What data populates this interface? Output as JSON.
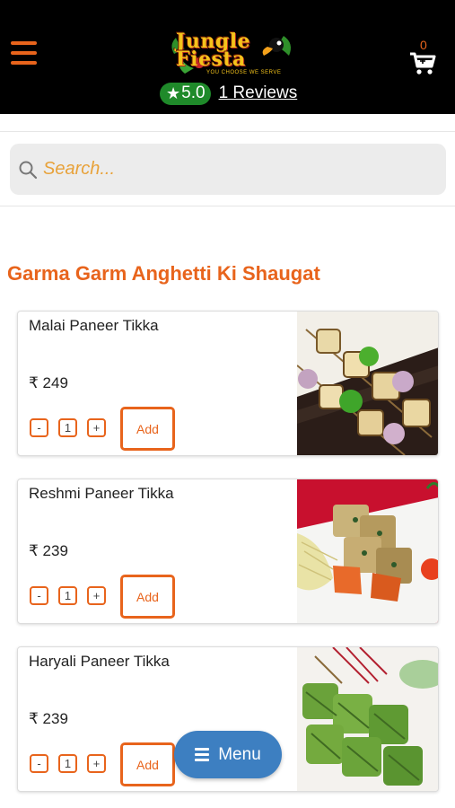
{
  "header": {
    "logo_text": "Jungle Fiesta",
    "logo_tagline": "YOU CHOOSE WE SERVE",
    "rating": "5.0",
    "reviews_label": "1 Reviews",
    "cart_count": "0"
  },
  "search": {
    "placeholder": "Search..."
  },
  "section": {
    "title": "Garma Garm Anghetti Ki Shaugat"
  },
  "items": [
    {
      "name": "Malai Paneer Tikka",
      "price": "₹ 249",
      "qty": "1",
      "minus": "-",
      "plus": "+",
      "add_label": "Add"
    },
    {
      "name": "Reshmi Paneer Tikka",
      "price": "₹ 239",
      "qty": "1",
      "minus": "-",
      "plus": "+",
      "add_label": "Add"
    },
    {
      "name": "Haryali Paneer Tikka",
      "price": "₹ 239",
      "qty": "1",
      "minus": "-",
      "plus": "+",
      "add_label": "Add"
    }
  ],
  "menu_button": {
    "label": "Menu"
  },
  "colors": {
    "header_bg": "#000000",
    "accent": "#e8641c",
    "rating_green": "#1f8a2a",
    "menu_blue": "#3d7fc1"
  },
  "icons": [
    "hamburger-icon",
    "star-icon",
    "cart-icon",
    "search-icon",
    "menu-lines-icon"
  ]
}
